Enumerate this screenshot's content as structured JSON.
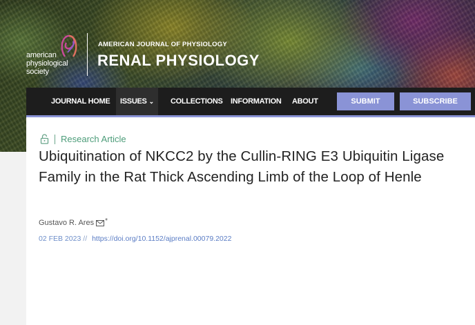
{
  "brand": {
    "org_line1": "american",
    "org_line2": "physiological",
    "org_line3": "society",
    "journal_superline": "AMERICAN JOURNAL OF PHYSIOLOGY",
    "journal_name": "RENAL PHYSIOLOGY"
  },
  "nav": {
    "items": [
      "JOURNAL HOME",
      "ISSUES",
      "COLLECTIONS",
      "INFORMATION",
      "ABOUT"
    ],
    "issues_chevron": "⌄",
    "submit_label": "SUBMIT",
    "subscribe_label": "SUBSCRIBE"
  },
  "article": {
    "type_label": "Research Article",
    "title": "Ubiquitination of NKCC2 by the Cullin-RING E3 Ubiquitin Ligase Family in the Rat Thick Ascending Limb of the Loop of Henle",
    "author": "Gustavo R. Ares",
    "author_mark": "*",
    "date": "02 FEB 2023",
    "date_separator": "//",
    "doi": "https://doi.org/10.1152/ajprenal.00079.2022"
  },
  "colors": {
    "nav_bg": "#1d1d1d",
    "accent": "#8a93d6",
    "type_green": "#4c9c79",
    "doi_blue": "#5a7cc4"
  },
  "icons": {
    "logo": "aps-logo-mark",
    "lock": "open-access-lock-icon",
    "mail": "envelope-icon"
  }
}
